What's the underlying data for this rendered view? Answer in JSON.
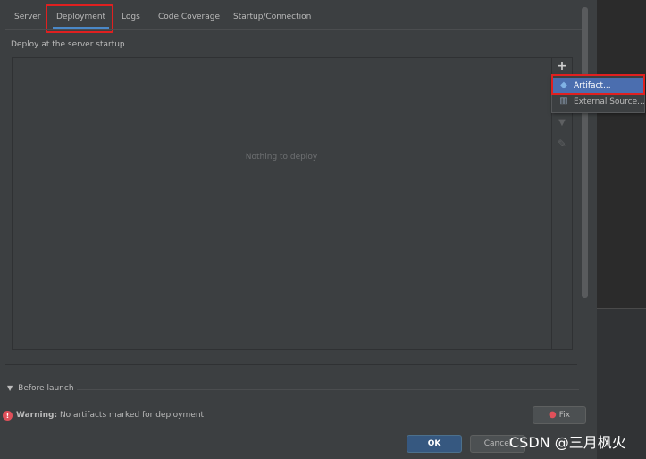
{
  "tabs": [
    {
      "label": "Server"
    },
    {
      "label": "Deployment",
      "active": true
    },
    {
      "label": "Logs"
    },
    {
      "label": "Code Coverage"
    },
    {
      "label": "Startup/Connection"
    }
  ],
  "deploy": {
    "section_label": "Deploy at the server startup",
    "empty_text": "Nothing to deploy"
  },
  "toolbar": {
    "add_icon": "plus-icon",
    "move_down_icon": "arrow-down-icon",
    "edit_icon": "pencil-icon"
  },
  "popup": {
    "items": [
      {
        "label": "Artifact...",
        "icon": "artifact-icon",
        "selected": true
      },
      {
        "label": "External Source...",
        "icon": "external-source-icon"
      }
    ]
  },
  "before_launch": {
    "label": "Before launch"
  },
  "warning": {
    "prefix": "Warning:",
    "message": "No artifacts marked for deployment"
  },
  "buttons": {
    "fix": "Fix",
    "ok": "OK",
    "cancel": "Cancel"
  },
  "watermark": "CSDN @三月枫火",
  "colors": {
    "background": "#3c3f41",
    "selection": "#4b6eaf",
    "highlight_box": "#e02020",
    "ok_button": "#365880",
    "warning": "#e0505a"
  }
}
